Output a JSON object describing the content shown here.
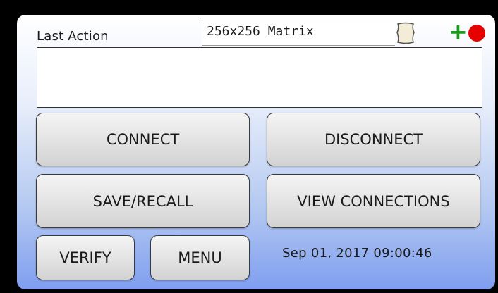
{
  "header": {
    "last_action_label": "Last Action",
    "matrix_name": "256x256 Matrix",
    "icons": {
      "shield": "shield-icon",
      "add": "plus-icon",
      "status": "record-icon"
    },
    "colors": {
      "add_icon": "#1b9b1b",
      "status_icon": "#e60000"
    }
  },
  "last_action": {
    "text": ""
  },
  "buttons": {
    "connect": "CONNECT",
    "disconnect": "DISCONNECT",
    "save_recall": "SAVE/RECALL",
    "view_connections": "VIEW CONNECTIONS",
    "verify": "VERIFY",
    "menu": "MENU"
  },
  "status": {
    "datetime": "Sep 01, 2017 09:00:46"
  }
}
